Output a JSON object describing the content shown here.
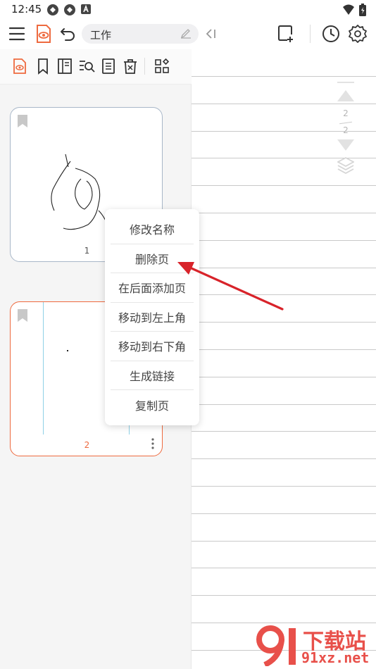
{
  "status_bar": {
    "time": "12:45"
  },
  "toolbar": {
    "title": "工作"
  },
  "thumbnails": [
    {
      "page_label": "1",
      "selected": false
    },
    {
      "page_label": "2",
      "selected": true
    }
  ],
  "pager": {
    "current": "2",
    "total": "2"
  },
  "context_menu": {
    "items": [
      "修改名称",
      "删除页",
      "在后面添加页",
      "移动到左上角",
      "移动到右下角",
      "生成链接",
      "复制页"
    ]
  },
  "watermark": {
    "line1": "下载站",
    "line2": "91xz.net"
  },
  "colors": {
    "accent": "#ee6a3f",
    "arrow": "#d8232a",
    "thumb_border": "#a8b7c8"
  },
  "icons": [
    "menu-icon",
    "reading-mode-icon",
    "undo-icon",
    "edit-pencil-icon",
    "collapse-panel-icon",
    "add-page-icon",
    "history-clock-icon",
    "settings-gear-icon"
  ]
}
